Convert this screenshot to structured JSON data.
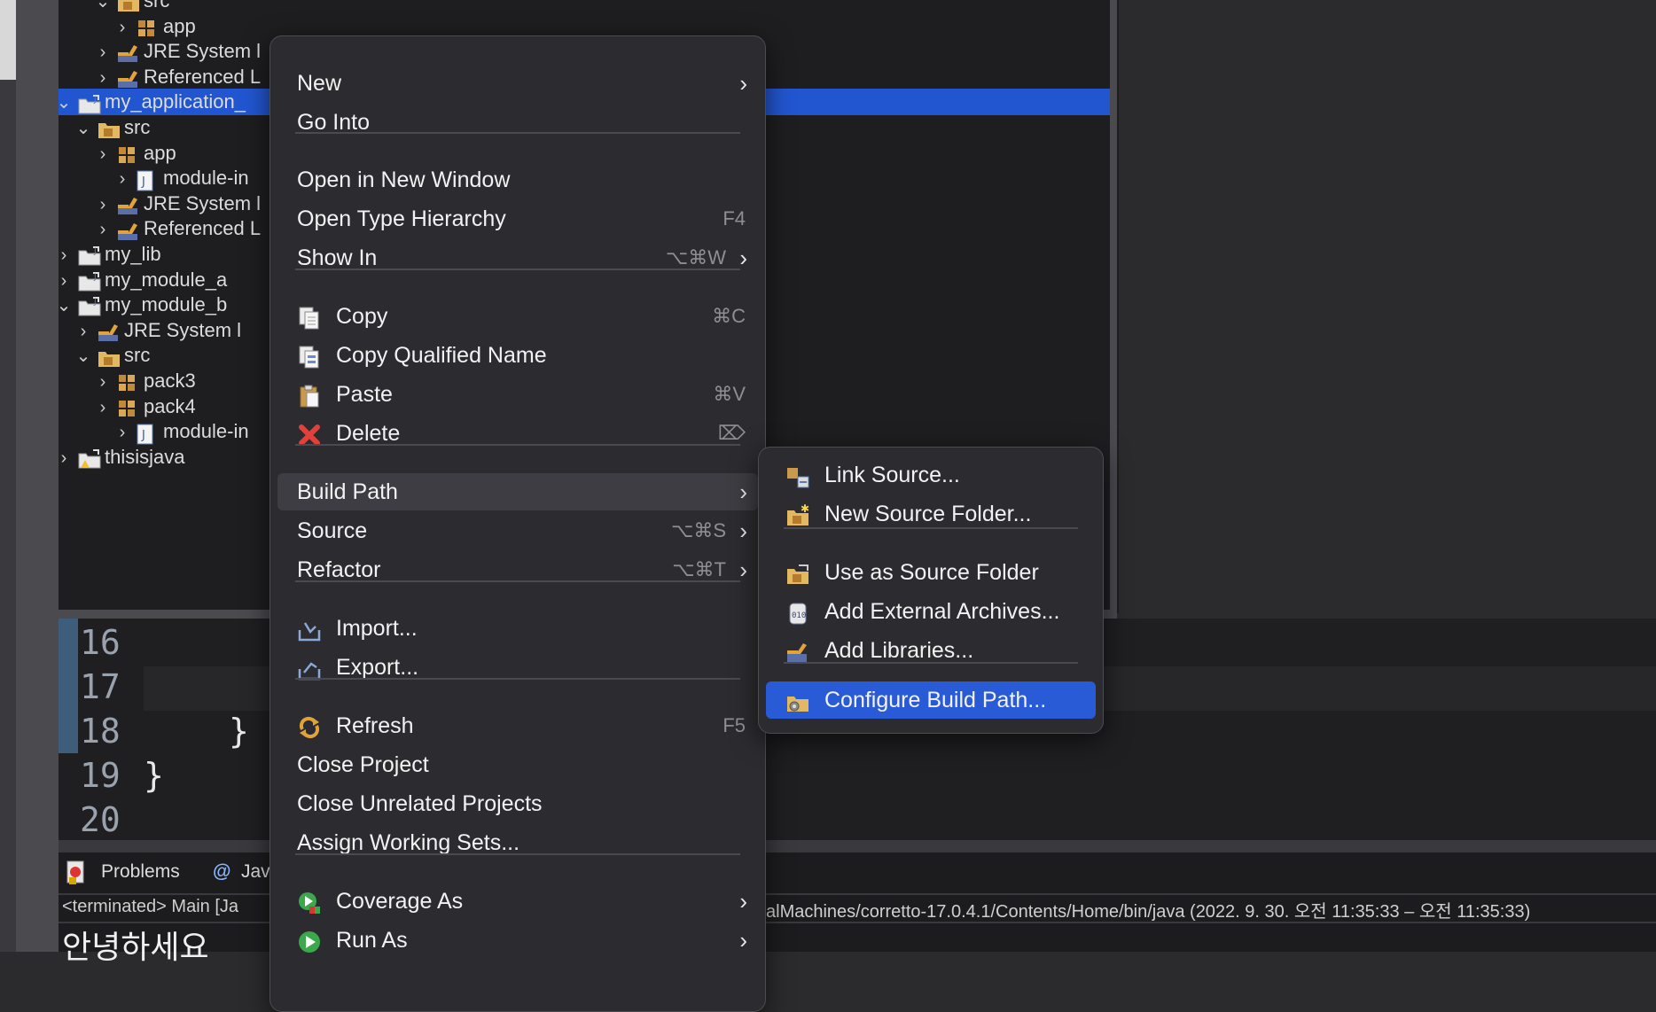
{
  "tree": {
    "rows": [
      {
        "label": "src",
        "chevron": "⌄",
        "icon": "package-folder-icon"
      },
      {
        "label": "app",
        "chevron": "›",
        "icon": "package-icon"
      },
      {
        "label": "JRE System l",
        "chevron": "›",
        "icon": "library-icon"
      },
      {
        "label": "Referenced L",
        "chevron": "›",
        "icon": "library-icon"
      },
      {
        "label": "my_application_",
        "chevron": "⌄",
        "icon": "project-icon",
        "selected": true
      },
      {
        "label": "src",
        "chevron": "⌄",
        "icon": "package-folder-icon"
      },
      {
        "label": "app",
        "chevron": "›",
        "icon": "package-icon"
      },
      {
        "label": "module-in",
        "chevron": "›",
        "icon": "java-file-icon"
      },
      {
        "label": "JRE System l",
        "chevron": "›",
        "icon": "library-icon"
      },
      {
        "label": "Referenced L",
        "chevron": "›",
        "icon": "library-icon"
      },
      {
        "label": "my_lib",
        "chevron": "›",
        "icon": "project-icon"
      },
      {
        "label": "my_module_a",
        "chevron": "›",
        "icon": "project-icon"
      },
      {
        "label": "my_module_b",
        "chevron": "⌄",
        "icon": "project-icon"
      },
      {
        "label": "JRE System l",
        "chevron": "›",
        "icon": "library-icon"
      },
      {
        "label": "src",
        "chevron": "⌄",
        "icon": "package-folder-icon"
      },
      {
        "label": "pack3",
        "chevron": "›",
        "icon": "package-icon"
      },
      {
        "label": "pack4",
        "chevron": "›",
        "icon": "package-icon"
      },
      {
        "label": "module-in",
        "chevron": "›",
        "icon": "java-file-icon"
      },
      {
        "label": "thisisjava",
        "chevron": "›",
        "icon": "project-warning-icon"
      }
    ]
  },
  "editor": {
    "line_numbers": [
      "16",
      "17",
      "18",
      "19",
      "20"
    ],
    "code_18": "}",
    "code_19": "}"
  },
  "bottom": {
    "tab_problems": "Problems",
    "tab_javadoc": "Jav",
    "console_left": "<terminated> Main [Ja",
    "console_right": "alMachines/corretto-17.0.4.1/Contents/Home/bin/java  (2022. 9. 30. 오전 11:35:33 – 오전 11:35:33)",
    "output": "안녕하세요"
  },
  "menu": {
    "new": "New",
    "go_into": "Go Into",
    "open_new_window": "Open in New Window",
    "open_type_hierarchy": "Open Type Hierarchy",
    "open_type_hierarchy_sc": "F4",
    "show_in": "Show In",
    "show_in_sc": "⌥⌘W",
    "copy": "Copy",
    "copy_sc": "⌘C",
    "copy_qualified": "Copy Qualified Name",
    "paste": "Paste",
    "paste_sc": "⌘V",
    "delete": "Delete",
    "delete_sc": "⌦",
    "build_path": "Build Path",
    "source": "Source",
    "source_sc": "⌥⌘S",
    "refactor": "Refactor",
    "refactor_sc": "⌥⌘T",
    "import": "Import...",
    "export": "Export...",
    "refresh": "Refresh",
    "refresh_sc": "F5",
    "close_project": "Close Project",
    "close_unrelated": "Close Unrelated Projects",
    "assign_working_sets": "Assign Working Sets...",
    "coverage_as": "Coverage As",
    "run_as": "Run As"
  },
  "submenu": {
    "link_source": "Link Source...",
    "new_source_folder": "New Source Folder...",
    "use_as_source_folder": "Use as Source Folder",
    "add_external_archives": "Add External Archives...",
    "add_libraries": "Add Libraries...",
    "configure_build_path": "Configure Build Path..."
  },
  "colors": {
    "selection": "#2256d1",
    "menu_bg": "#2c2c30",
    "active_item": "#2a5bd6"
  }
}
